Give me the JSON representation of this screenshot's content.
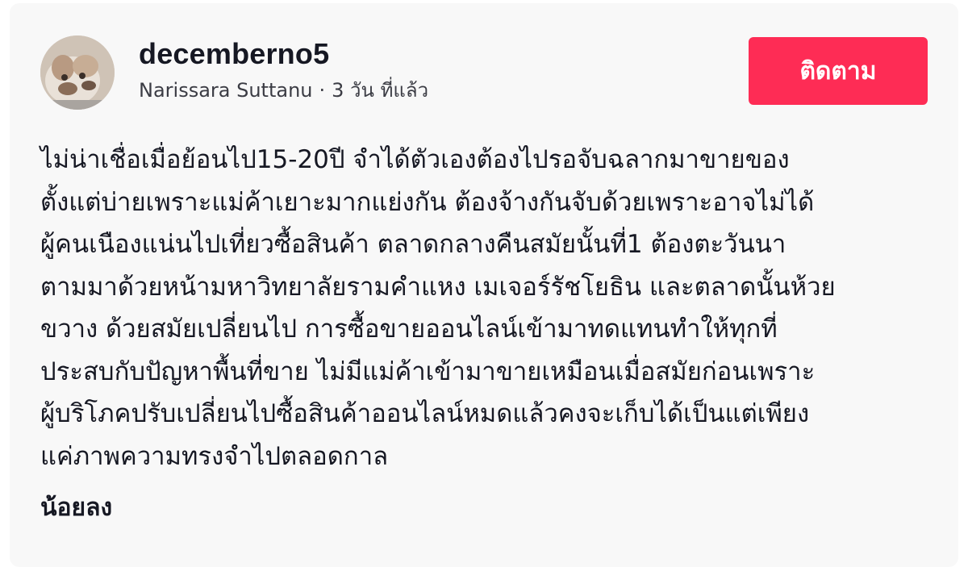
{
  "post": {
    "username": "decemberno5",
    "display_name": "Narissara Suttanu",
    "separator": "·",
    "time_ago": "3 วัน ที่แล้ว",
    "follow_label": "ติดตาม",
    "caption_lines": [
      "ไม่น่าเชื่อเมื่อย้อนไป15-20ปี จำได้ตัวเองต้องไปรอจับฉลากมาขายของ",
      "ตั้งแต่บ่ายเพราะแม่ค้าเยาะมากแย่งกัน ต้องจ้างกันจับด้วยเพราะอาจไม่ได้",
      "ผู้คนเนืองแน่นไปเที่ยวซื้อสินค้า ตลาดกลางคืนสมัยนั้นที่1 ต้องตะวันนา",
      "ตามมาด้วยหน้ามหาวิทยาลัยรามคำแหง เมเจอร์รัชโยธิน และตลาดนั้นห้วย",
      "ขวาง ด้วยสมัยเปลี่ยนไป การซื้อขายออนไลน์เข้ามาทดแทนทำให้ทุกที่",
      "ประสบกับปัญหาพื้นที่ขาย ไม่มีแม่ค้าเข้ามาขายเหมือนเมื่อสมัยก่อนเพราะ",
      "ผู้บริโภคปรับเปลี่ยนไปซื้อสินค้าออนไลน์หมดแล้วคงจะเก็บได้เป็นแต่เพียง",
      "แค่ภาพความทรงจำไปตลอดกาล"
    ],
    "see_less_label": "น้อยลง"
  },
  "colors": {
    "follow_button_bg": "#fe2c55",
    "card_bg": "#f8f8f8",
    "text_primary": "#161823"
  },
  "icons": {
    "avatar": "cat-photo-avatar"
  }
}
